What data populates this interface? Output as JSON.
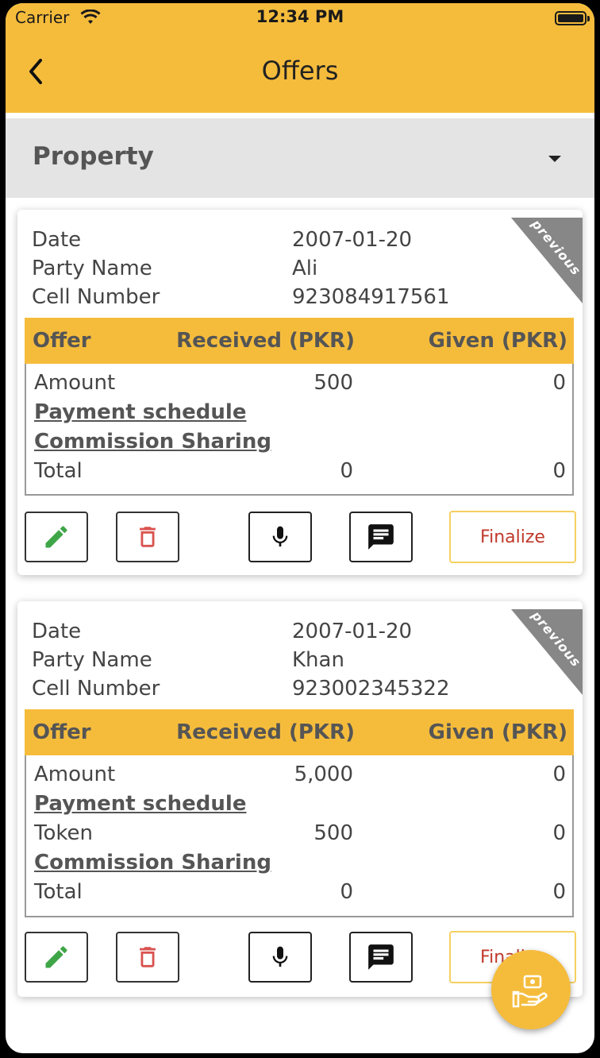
{
  "status_bar": {
    "carrier": "Carrier",
    "time": "12:34 PM"
  },
  "nav": {
    "title": "Offers"
  },
  "filter": {
    "selected": "Property"
  },
  "labels": {
    "date": "Date",
    "party_name": "Party Name",
    "cell_number": "Cell Number",
    "offer": "Offer",
    "received": "Received (PKR)",
    "given": "Given (PKR)",
    "amount": "Amount",
    "payment_schedule": "Payment schedule",
    "commission_sharing": "Commission Sharing",
    "token": "Token",
    "total": "Total",
    "finalize": "Finalize",
    "ribbon": "previous"
  },
  "offers": [
    {
      "date": "2007-01-20",
      "party_name": "Ali",
      "cell_number": "923084917561",
      "amount_received": "500",
      "amount_given": "0",
      "total_received": "0",
      "total_given": "0"
    },
    {
      "date": "2007-01-20",
      "party_name": "Khan",
      "cell_number": "923002345322",
      "amount_received": "5,000",
      "amount_given": "0",
      "token_received": "500",
      "token_given": "0",
      "total_received": "0",
      "total_given": "0"
    }
  ],
  "colors": {
    "accent": "#F5BC3C",
    "edit": "#3FA648",
    "delete": "#D9534F",
    "finalize_text": "#C0392B"
  }
}
